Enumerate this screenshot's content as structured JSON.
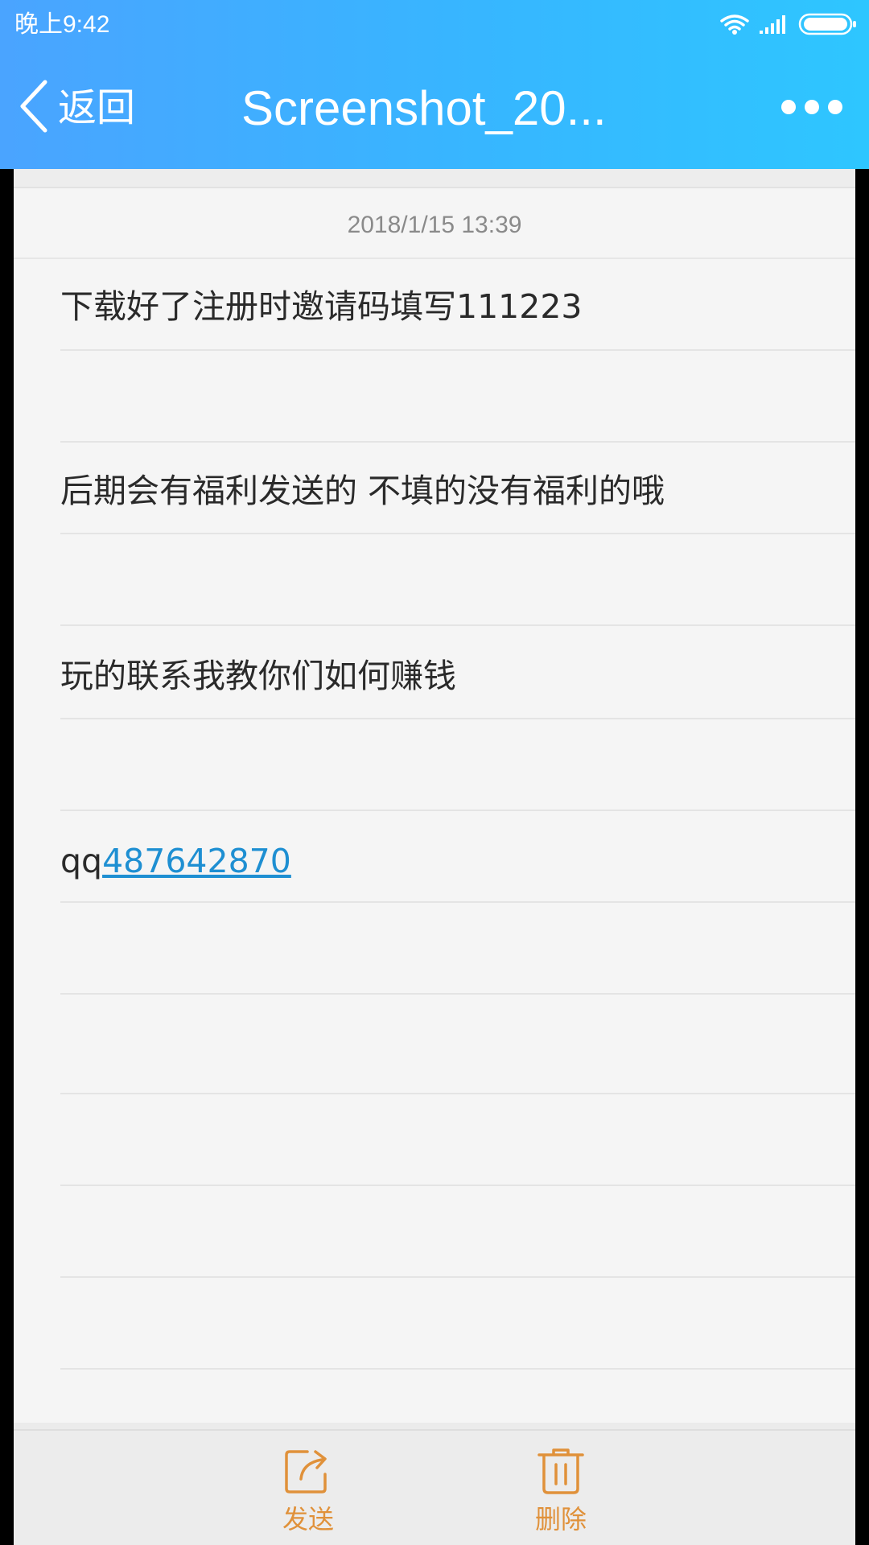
{
  "status_bar": {
    "time": "晚上9:42",
    "icons": [
      "wifi-icon",
      "signal-icon",
      "battery-icon"
    ]
  },
  "header": {
    "back_label": "返回",
    "title": "Screenshot_20...",
    "more_icon": "more-dots-icon"
  },
  "note": {
    "timestamp": "2018/1/15 13:39",
    "lines": [
      "下载好了注册时邀请码填写111223",
      "",
      "后期会有福利发送的  不填的没有福利的哦",
      "",
      "玩的联系我教你们如何赚钱",
      "",
      "qq487642870"
    ],
    "qq_prefix": "qq",
    "qq_number": "487642870"
  },
  "toolbar": {
    "send_label": "发送",
    "send_icon": "share-icon",
    "delete_label": "删除",
    "delete_icon": "trash-icon"
  },
  "colors": {
    "header_gradient_start": "#4aa4ff",
    "header_gradient_end": "#2ec6ff",
    "note_background": "#f5f5f5",
    "link": "#1e8fd2",
    "toolbar_accent": "#e0913a"
  }
}
